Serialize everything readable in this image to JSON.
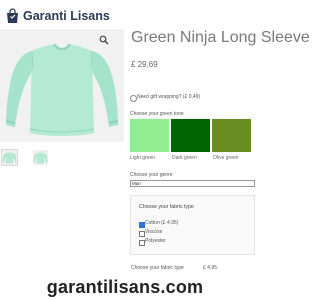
{
  "header": {
    "logo_text": "Garanti Lisans",
    "logo_icon": "shopping-bag-icon"
  },
  "gallery": {
    "zoom_icon": "magnifier-icon",
    "sweater_color": "#a6e3cc",
    "thumbnail_count": 2
  },
  "product": {
    "title": "Green Ninja Long Sleeve",
    "price": "£ 29,69"
  },
  "options": {
    "gift_label": "Need gift wrapping? (£ 0,49)",
    "green_tone_label": "Choose your green tone",
    "swatches": [
      {
        "name": "Light green",
        "color": "#90ee90"
      },
      {
        "name": "Dark green",
        "color": "#006400"
      },
      {
        "name": "Olive green",
        "color": "#6b8e23"
      }
    ],
    "genre_label": "Choose your genre",
    "genre_value": "Man"
  },
  "fabric": {
    "title": "Choose your fabric type",
    "options": [
      {
        "label": "Cotton (£ 4,95)",
        "checked": true
      },
      {
        "label": "Viscose",
        "checked": false
      },
      {
        "label": "Polyester",
        "checked": false
      }
    ],
    "total_label": "Choose your fabric type",
    "total_value": "£ 4,95"
  },
  "watermark": {
    "text": "garantilisans.com"
  },
  "colors": {
    "brand": "#2c3a57",
    "accent": "#2f6fd6"
  }
}
